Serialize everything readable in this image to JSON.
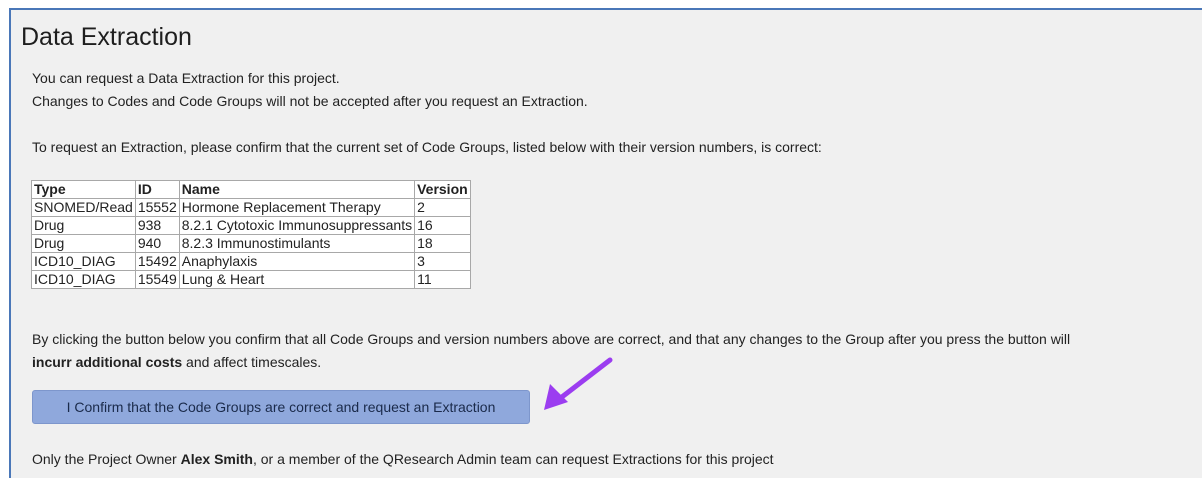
{
  "page": {
    "title": "Data Extraction",
    "intro_line1": "You can request a Data Extraction for this project.",
    "intro_line2": "Changes to Codes and Code Groups will not be accepted after you request an Extraction.",
    "confirm_prompt": "To request an Extraction, please confirm that the current set of Code Groups, listed below with their version numbers, is correct:"
  },
  "table": {
    "headers": [
      "Type",
      "ID",
      "Name",
      "Version"
    ],
    "rows": [
      [
        "SNOMED/Read",
        "15552",
        "Hormone Replacement Therapy",
        "2"
      ],
      [
        "Drug",
        "938",
        "8.2.1 Cytotoxic Immunosuppressants",
        "16"
      ],
      [
        "Drug",
        "940",
        "8.2.3 Immunostimulants",
        "18"
      ],
      [
        "ICD10_DIAG",
        "15492",
        "Anaphylaxis",
        "3"
      ],
      [
        "ICD10_DIAG",
        "15549",
        "Lung & Heart",
        "11"
      ]
    ]
  },
  "notice": {
    "part1": "By clicking the button below you confirm that all Code Groups and version numbers above are correct, and that any changes to the Group after you press the button will",
    "bold": "incurr additional costs",
    "part2": " and affect timescales."
  },
  "button": {
    "label": "I Confirm that the Code Groups are correct and request an Extraction"
  },
  "owner": {
    "prefix": "Only the Project Owner ",
    "name": "Alex Smith",
    "suffix": ", or a member of the QResearch Admin team can request Extractions for this project"
  },
  "annotation": {
    "icon": "arrow-annotation-icon",
    "color": "#9b3df0"
  },
  "colors": {
    "accent_border": "#4a77b8",
    "button_bg": "#8fa8dc"
  }
}
